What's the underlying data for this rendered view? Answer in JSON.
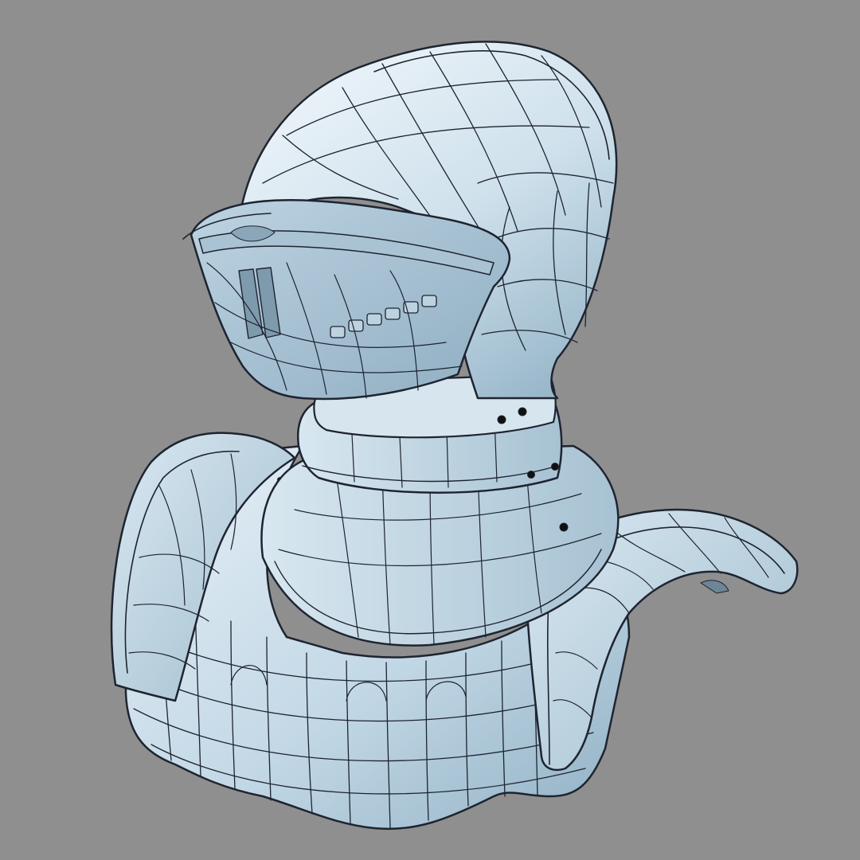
{
  "viewport": {
    "background_color": "#8f8f8f",
    "subject": "knight-helmet-and-pauldrons-wireframe"
  },
  "model": {
    "shade_color": "#c4d9e6",
    "highlight_color": "#e3eef5",
    "shadow_color": "#7fa0b5",
    "wire_color": "#1e2430",
    "bolt_color": "#111111",
    "parts": [
      "helmet-dome",
      "visor",
      "gorget",
      "left-pauldron",
      "right-pauldron",
      "breastplate"
    ]
  }
}
